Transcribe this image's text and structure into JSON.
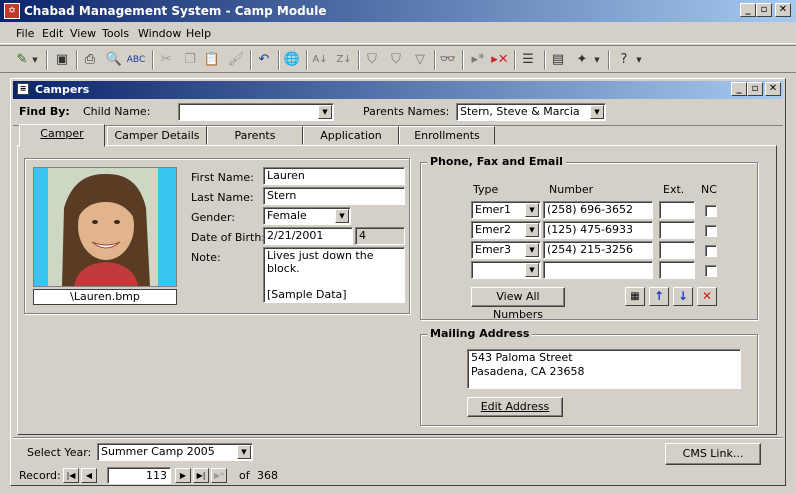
{
  "app": {
    "title": "Chabad Management System - Camp Module"
  },
  "menu": {
    "file": "File",
    "edit": "Edit",
    "view": "View",
    "tools": "Tools",
    "window": "Window",
    "help": "Help"
  },
  "form": {
    "title": "Campers"
  },
  "findby": {
    "label": "Find By:",
    "child_label": "Child Name:",
    "child_value": "",
    "parents_label": "Parents Names:",
    "parents_value": "Stern, Steve & Marcia"
  },
  "tabs": [
    "Camper",
    "Camper Details",
    "Parents",
    "Application",
    "Enrollments"
  ],
  "camper": {
    "photo_caption": "\\Lauren.bmp",
    "first_name_label": "First Name:",
    "first_name": "Lauren",
    "last_name_label": "Last Name:",
    "last_name": "Stern",
    "gender_label": "Gender:",
    "gender": "Female",
    "dob_label": "Date of Birth:",
    "dob": "2/21/2001",
    "age": "4",
    "note_label": "Note:",
    "note_line1": "Lives just down the",
    "note_line2": "block.",
    "note_line3": "[Sample Data]"
  },
  "phone": {
    "title": "Phone, Fax and Email",
    "col_type": "Type",
    "col_number": "Number",
    "col_ext": "Ext.",
    "col_nc": "NC",
    "rows": [
      {
        "type": "Emer1",
        "number": "(258) 696-3652",
        "ext": ""
      },
      {
        "type": "Emer2",
        "number": "(125) 475-6933",
        "ext": ""
      },
      {
        "type": "Emer3",
        "number": "(254) 215-3256",
        "ext": ""
      },
      {
        "type": "",
        "number": "",
        "ext": ""
      }
    ],
    "view_all_label": "View All Numbers"
  },
  "mailing": {
    "title": "Mailing Address",
    "line1": "543 Paloma Street",
    "line2": "Pasadena, CA 23658",
    "edit_label": "Edit Address"
  },
  "footer": {
    "year_label": "Select Year:",
    "year_value": "Summer Camp 2005",
    "cms_link_label": "CMS Link..."
  },
  "record": {
    "label": "Record:",
    "current": "113",
    "of_label": "of",
    "total": "368"
  },
  "colors": {
    "titlebar_start": "#0a246a",
    "titlebar_end": "#a6caf0",
    "face": "#d4d0c8",
    "photo_bg": "#35c5f0",
    "nav_arrow": "#1f3fbf",
    "delete_red": "#cc2222"
  }
}
